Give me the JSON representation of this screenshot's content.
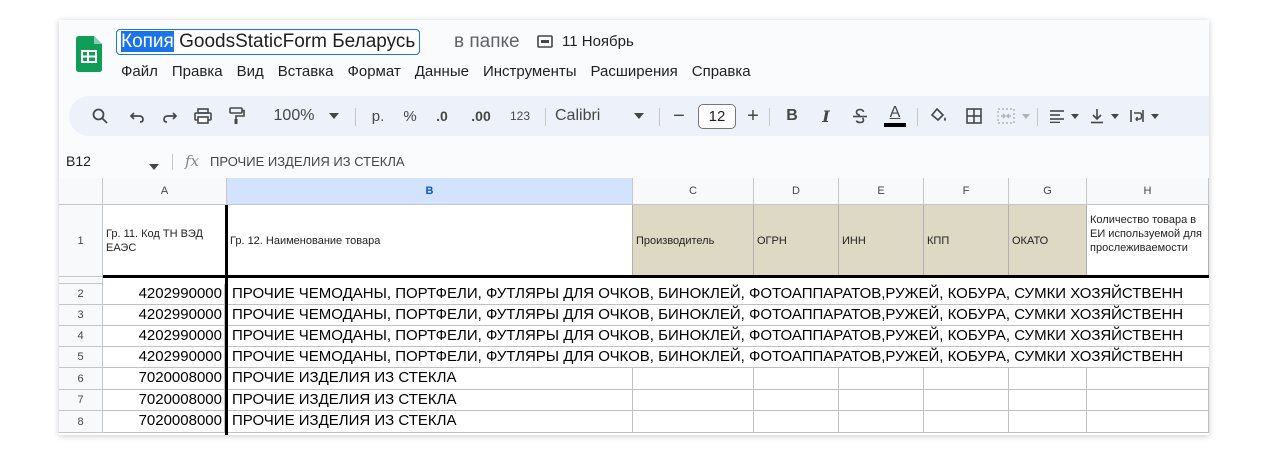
{
  "header": {
    "title_selected": "Копия",
    "title_rest": " GoodsStaticForm Беларусь",
    "in_folder_label": "в папке",
    "folder_icon": "folder-icon",
    "folder_name": "11 Ноябрь",
    "logo_icon": "sheets-logo-icon"
  },
  "menu": {
    "items": [
      "Файл",
      "Правка",
      "Вид",
      "Вставка",
      "Формат",
      "Данные",
      "Инструменты",
      "Расширения",
      "Справка"
    ]
  },
  "toolbar": {
    "zoom": "100%",
    "currency": "р.",
    "percent": "%",
    "decrease_decimals": ".0",
    "increase_decimals": ".00",
    "number_format": "123",
    "font": "Calibri",
    "font_size": "12",
    "minus": "−",
    "plus": "+",
    "bold": "B",
    "italic": "I",
    "text_color_letter": "A"
  },
  "formula_bar": {
    "name_box": "B12",
    "fx": "fx",
    "content": "ПРОЧИЕ ИЗДЕЛИЯ ИЗ СТЕКЛА"
  },
  "grid": {
    "columns": [
      "A",
      "B",
      "C",
      "D",
      "E",
      "F",
      "G",
      "H"
    ],
    "active_column": "B",
    "header_row": {
      "row": "1",
      "cells": [
        "Гр. 11. Код ТН ВЭД ЕАЭС",
        "Гр. 12. Наименование товара",
        "Производитель",
        "ОГРН",
        "ИНН",
        "КПП",
        "ОКАТО",
        "Количество товара в ЕИ используемой для прослеживаемости"
      ]
    },
    "rows": [
      {
        "row": "2",
        "code": "4202990000",
        "name": "ПРОЧИЕ ЧЕМОДАНЫ, ПОРТФЕЛИ, ФУТЛЯРЫ ДЛЯ ОЧКОВ, БИНОКЛЕЙ, ФОТОАППАРАТОВ,РУЖЕЙ, КОБУРА, СУМКИ ХОЗЯЙСТВЕНН"
      },
      {
        "row": "3",
        "code": "4202990000",
        "name": "ПРОЧИЕ ЧЕМОДАНЫ, ПОРТФЕЛИ, ФУТЛЯРЫ ДЛЯ ОЧКОВ, БИНОКЛЕЙ, ФОТОАППАРАТОВ,РУЖЕЙ, КОБУРА, СУМКИ ХОЗЯЙСТВЕНН"
      },
      {
        "row": "4",
        "code": "4202990000",
        "name": "ПРОЧИЕ ЧЕМОДАНЫ, ПОРТФЕЛИ, ФУТЛЯРЫ ДЛЯ ОЧКОВ, БИНОКЛЕЙ, ФОТОАППАРАТОВ,РУЖЕЙ, КОБУРА, СУМКИ ХОЗЯЙСТВЕНН"
      },
      {
        "row": "5",
        "code": "4202990000",
        "name": "ПРОЧИЕ ЧЕМОДАНЫ, ПОРТФЕЛИ, ФУТЛЯРЫ ДЛЯ ОЧКОВ, БИНОКЛЕЙ, ФОТОАППАРАТОВ,РУЖЕЙ, КОБУРА, СУМКИ ХОЗЯЙСТВЕНН"
      },
      {
        "row": "6",
        "code": "7020008000",
        "name": "ПРОЧИЕ ИЗДЕЛИЯ ИЗ СТЕКЛА"
      },
      {
        "row": "7",
        "code": "7020008000",
        "name": "ПРОЧИЕ ИЗДЕЛИЯ ИЗ СТЕКЛА"
      },
      {
        "row": "8",
        "code": "7020008000",
        "name": "ПРОЧИЕ ИЗДЕЛИЯ ИЗ СТЕКЛА"
      }
    ]
  },
  "colors": {
    "accent": "#1a73e8",
    "header_tan": "#ddd9c4",
    "active_column_header": "#d3e3fd",
    "toolbar_bg": "#edf2fa",
    "sheets_green": "#0f9d58"
  }
}
